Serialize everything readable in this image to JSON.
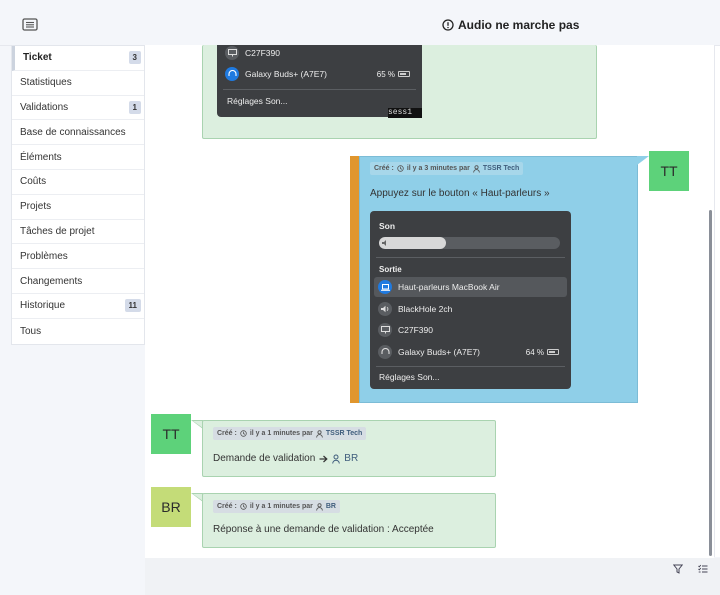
{
  "header": {
    "title": "Audio ne marche pas",
    "menu_icon": "sidebar-toggle-icon",
    "title_icon": "exclamation-circle-icon"
  },
  "sidebar": {
    "items": [
      {
        "label": "Ticket",
        "badge": "3",
        "active": true
      },
      {
        "label": "Statistiques",
        "badge": ""
      },
      {
        "label": "Validations",
        "badge": "1"
      },
      {
        "label": "Base de connaissances",
        "badge": ""
      },
      {
        "label": "Éléments",
        "badge": ""
      },
      {
        "label": "Coûts",
        "badge": ""
      },
      {
        "label": "Projets",
        "badge": ""
      },
      {
        "label": "Tâches de projet",
        "badge": ""
      },
      {
        "label": "Problèmes",
        "badge": ""
      },
      {
        "label": "Changements",
        "badge": ""
      },
      {
        "label": "Historique",
        "badge": "11"
      },
      {
        "label": "Tous",
        "badge": ""
      }
    ]
  },
  "timeline": {
    "top_image": {
      "rows": [
        {
          "label": "C27F390",
          "icon": "monitor-icon"
        },
        {
          "label": "Galaxy Buds+ (A7E7)",
          "icon": "headphones-icon",
          "battery": "65 %"
        }
      ],
      "footer": "Réglages Son...",
      "cut_text": "sess1"
    },
    "followup": {
      "avatar": "TT",
      "meta_prefix": "Créé :",
      "meta_time": "il y a 3 minutes par",
      "meta_author": "TSSR Tech",
      "text": "Appuyez sur le bouton « Haut-parleurs »",
      "image": {
        "son_label": "Son",
        "volume_fraction": 0.37,
        "output_label": "Sortie",
        "rows": [
          {
            "label": "Haut-parleurs MacBook Air",
            "icon": "laptop-icon",
            "selected": true
          },
          {
            "label": "BlackHole 2ch",
            "icon": "speaker-icon"
          },
          {
            "label": "C27F390",
            "icon": "monitor-icon"
          },
          {
            "label": "Galaxy Buds+ (A7E7)",
            "icon": "headphones-icon",
            "battery": "64 %"
          }
        ],
        "footer": "Réglages Son..."
      }
    },
    "validation_request": {
      "avatar": "TT",
      "meta_prefix": "Créé :",
      "meta_time": "il y a 1 minutes par",
      "meta_author": "TSSR Tech",
      "text": "Demande de validation",
      "target": "BR"
    },
    "validation_answer": {
      "avatar": "BR",
      "meta_prefix": "Créé :",
      "meta_time": "il y a 1 minutes par",
      "meta_author": "BR",
      "text": "Réponse à une demande de validation : Acceptée"
    }
  },
  "footer": {
    "filter_icon": "filter-icon",
    "list_icon": "list-settings-icon"
  },
  "colors": {
    "accent_orange": "#e0962e",
    "bubble_blue": "#8fcfe8",
    "bubble_green": "#dcefdf",
    "avatar_tt": "#5dd27a",
    "avatar_br": "#c4dc78"
  }
}
